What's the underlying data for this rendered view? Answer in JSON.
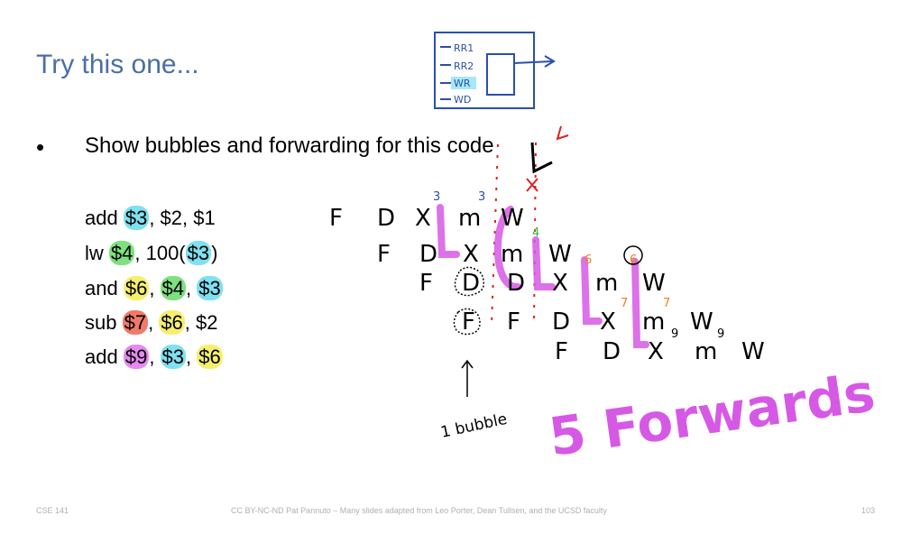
{
  "slide": {
    "title": "Try this one...",
    "bullet_symbol": "•",
    "bullet_text": "Show bubbles and forwarding for this code",
    "code": [
      {
        "op": "add",
        "args": [
          {
            "text": "$3",
            "hl": "#7fe0f0"
          },
          {
            "text": ", $2, $1",
            "hl": null
          }
        ]
      },
      {
        "op": "lw",
        "args": [
          {
            "text": "$4",
            "hl": "#7ee07e"
          },
          {
            "text": ", 100(",
            "hl": null
          },
          {
            "text": "$3",
            "hl": "#7fe0f0"
          },
          {
            "text": ")",
            "hl": null
          }
        ]
      },
      {
        "op": "and",
        "args": [
          {
            "text": "$6",
            "hl": "#f6ef6e"
          },
          {
            "text": ", ",
            "hl": null
          },
          {
            "text": "$4",
            "hl": "#7ee07e"
          },
          {
            "text": ", ",
            "hl": null
          },
          {
            "text": "$3",
            "hl": "#7fe0f0"
          }
        ]
      },
      {
        "op": "sub",
        "args": [
          {
            "text": "$7",
            "hl": "#f07a6a"
          },
          {
            "text": ", ",
            "hl": null
          },
          {
            "text": "$6",
            "hl": "#f6ef6e"
          },
          {
            "text": ", $2",
            "hl": null
          }
        ]
      },
      {
        "op": "add",
        "args": [
          {
            "text": "$9",
            "hl": "#e58af0"
          },
          {
            "text": ", ",
            "hl": null
          },
          {
            "text": "$3",
            "hl": "#7fe0f0"
          },
          {
            "text": ", ",
            "hl": null
          },
          {
            "text": "$6",
            "hl": "#f6ef6e"
          }
        ]
      }
    ],
    "pipeline_rows": [
      [
        "F",
        "D",
        "X",
        "m",
        "W"
      ],
      [
        "F",
        "D",
        "X",
        "m",
        "W"
      ],
      [
        "F",
        "D",
        "D",
        "X",
        "m",
        "W"
      ],
      [
        "F",
        "F",
        "D",
        "X",
        "m",
        "W"
      ],
      [
        "F",
        "D",
        "X",
        "m",
        "W"
      ]
    ],
    "annotations": {
      "bubble_note": "1 bubble",
      "forwards_note": "5 Forwards",
      "regfile_labels": [
        "RR1",
        "RR2",
        "WR",
        "WD"
      ],
      "reg_superscripts": [
        "3",
        "3",
        "4",
        "6",
        "6",
        "7",
        "7",
        "9",
        "9"
      ]
    },
    "colors": {
      "title": "#4a6fa5",
      "forward_ink": "#d659e6",
      "hazard_ink": "#e02020",
      "sketch_ink": "#2a4fb0"
    },
    "footer": {
      "left": "CSE 141",
      "center": "CC BY-NC-ND Pat Pannuto – Many slides adapted from Leo Porter, Dean Tullsen, and the UCSD faculty",
      "page": "103"
    }
  }
}
